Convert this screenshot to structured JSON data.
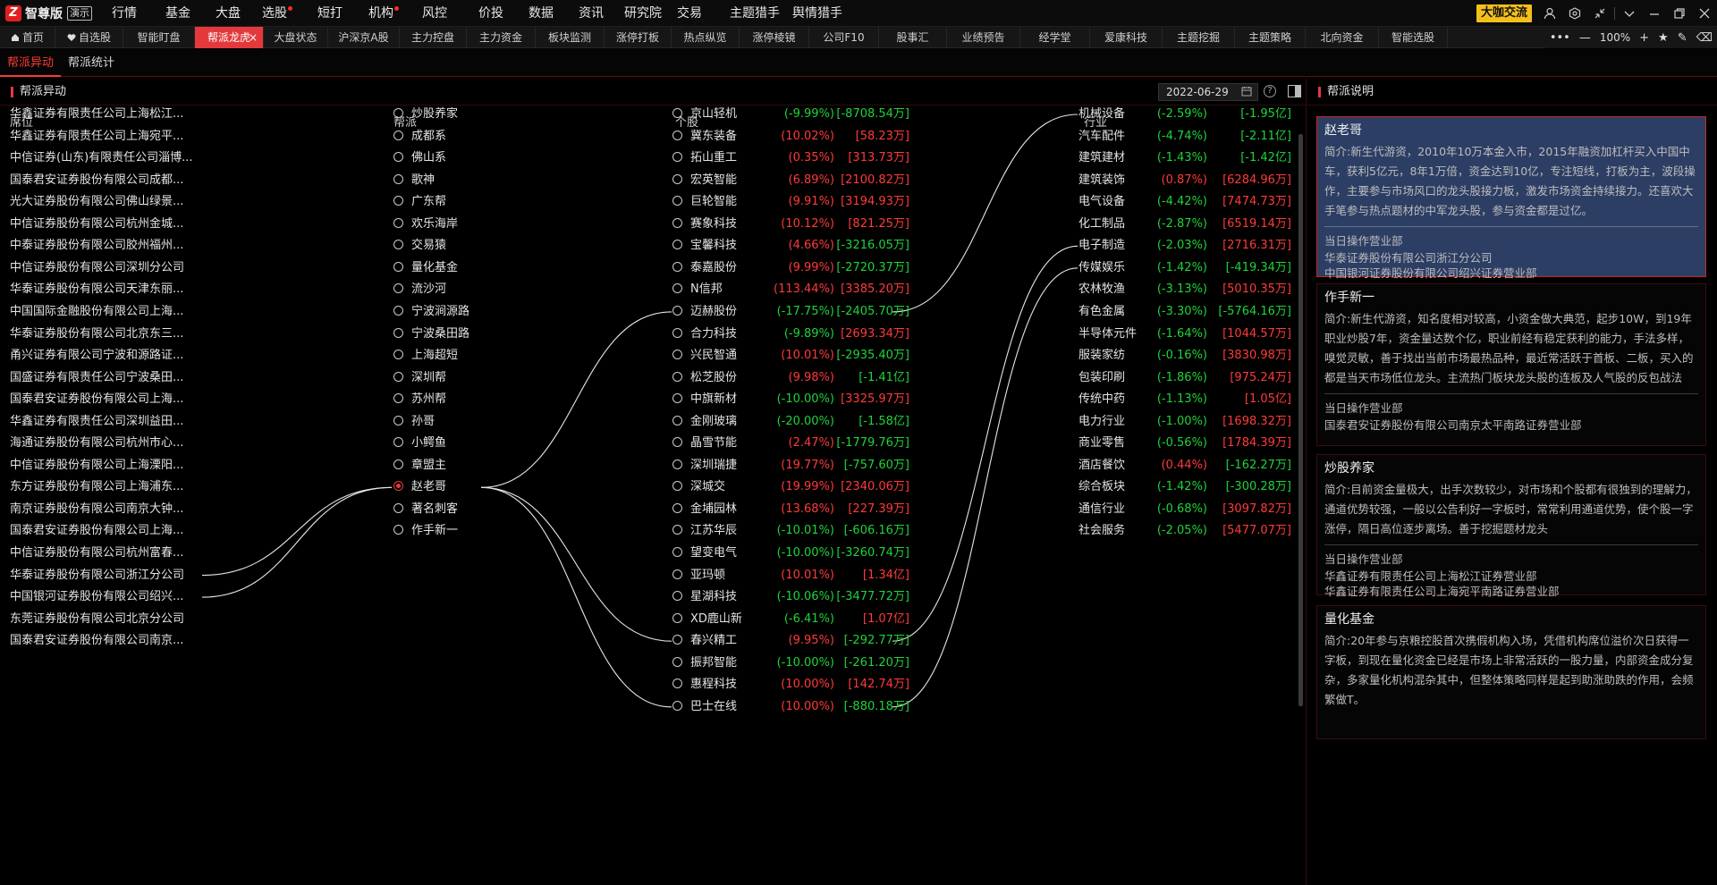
{
  "app": {
    "logo_glyph": "Z",
    "name": "智尊版",
    "demo_badge": "演示"
  },
  "menus": [
    {
      "label": "行情",
      "dot": false
    },
    {
      "label": "基金",
      "dot": false
    },
    {
      "label": "大盘",
      "dot": false
    },
    {
      "label": "选股",
      "dot": true
    },
    {
      "label": "短打",
      "dot": false
    },
    {
      "label": "机构",
      "dot": true
    },
    {
      "label": "风控",
      "dot": false
    },
    {
      "label": "价投",
      "dot": false
    },
    {
      "label": "数据",
      "dot": false
    },
    {
      "label": "资讯",
      "dot": false
    },
    {
      "label": "研究院",
      "dot": false
    },
    {
      "label": "交易",
      "dot": false
    },
    {
      "label": "主题猎手",
      "dot": false
    },
    {
      "label": "舆情猎手",
      "dot": false
    }
  ],
  "topright": {
    "chat_label": "大咖交流",
    "icons": [
      "user-icon",
      "settings-icon",
      "shrink-icon",
      "chevron-down-icon",
      "minimize-icon",
      "restore-icon",
      "close-icon"
    ]
  },
  "tabs": [
    {
      "label": "首页",
      "icon": "home-icon"
    },
    {
      "label": "自选股",
      "icon": "heart-icon"
    },
    {
      "label": "智能盯盘"
    },
    {
      "label": "帮派龙虎",
      "active": true
    },
    {
      "label": "大盘状态"
    },
    {
      "label": "沪深京A股"
    },
    {
      "label": "主力控盘"
    },
    {
      "label": "主力资金"
    },
    {
      "label": "板块监测"
    },
    {
      "label": "涨停打板"
    },
    {
      "label": "热点纵览"
    },
    {
      "label": "涨停棱镜"
    },
    {
      "label": "公司F10"
    },
    {
      "label": "股事汇"
    },
    {
      "label": "业绩预告"
    },
    {
      "label": "经学堂"
    },
    {
      "label": "爱康科技"
    },
    {
      "label": "主题挖掘"
    },
    {
      "label": "主题策略"
    },
    {
      "label": "北向资金"
    },
    {
      "label": "智能选股"
    }
  ],
  "tab_tools": {
    "more": "•••",
    "minus": "—",
    "zoom": "100%",
    "plus": "+",
    "star": "★",
    "edit": "✎",
    "eraser": "⌫"
  },
  "subtabs": [
    {
      "label": "帮派异动",
      "active": true
    },
    {
      "label": "帮派统计",
      "active": false
    }
  ],
  "left": {
    "section_title": "帮派异动",
    "date": "2022-06-29",
    "columns": {
      "seat": "席位",
      "faction": "帮派",
      "stock": "个股",
      "industry": "行业"
    },
    "seats": [
      "华鑫证券有限责任公司上海松江...",
      "华鑫证券有限责任公司上海宛平...",
      "中信证券(山东)有限责任公司淄博...",
      "国泰君安证券股份有限公司成都...",
      "光大证券股份有限公司佛山绿景...",
      "中信证券股份有限公司杭州金城...",
      "中泰证券股份有限公司胶州福州...",
      "中信证券股份有限公司深圳分公司",
      "华泰证券股份有限公司天津东丽...",
      "中国国际金融股份有限公司上海...",
      "华泰证券股份有限公司北京东三...",
      "甬兴证券有限公司宁波和源路证...",
      "国盛证券有限责任公司宁波桑田...",
      "国泰君安证券股份有限公司上海...",
      "华鑫证券有限责任公司深圳益田...",
      "海通证券股份有限公司杭州市心...",
      "中信证券股份有限公司上海溧阳...",
      "东方证券股份有限公司上海浦东...",
      "南京证券股份有限公司南京大钟...",
      "国泰君安证券股份有限公司上海...",
      "中信证券股份有限公司杭州富春...",
      "华泰证券股份有限公司浙江分公司",
      "中国银河证券股份有限公司绍兴...",
      "东莞证券股份有限公司北京分公司",
      "国泰君安证券股份有限公司南京..."
    ],
    "factions": [
      "炒股养家",
      "成都系",
      "佛山系",
      "歌神",
      "广东帮",
      "欢乐海岸",
      "交易猿",
      "量化基金",
      "流沙河",
      "宁波涧源路",
      "宁波桑田路",
      "上海超短",
      "深圳帮",
      "苏州帮",
      "孙哥",
      "小鳄鱼",
      "章盟主",
      "赵老哥",
      "著名刺客",
      "作手新一"
    ],
    "selected_faction": "赵老哥",
    "stocks": [
      {
        "name": "京山轻机",
        "pct": "(-9.99%)",
        "amt": "[-8708.54万]",
        "dir": "dn",
        "amt_dir": "dn"
      },
      {
        "name": "冀东装备",
        "pct": "(10.02%)",
        "amt": "[58.23万]",
        "dir": "up",
        "amt_dir": "up"
      },
      {
        "name": "拓山重工",
        "pct": "(0.35%)",
        "amt": "[313.73万]",
        "dir": "up",
        "amt_dir": "up"
      },
      {
        "name": "宏英智能",
        "pct": "(6.89%)",
        "amt": "[2100.82万]",
        "dir": "up",
        "amt_dir": "up"
      },
      {
        "name": "巨轮智能",
        "pct": "(9.91%)",
        "amt": "[3194.93万]",
        "dir": "up",
        "amt_dir": "up"
      },
      {
        "name": "赛象科技",
        "pct": "(10.12%)",
        "amt": "[821.25万]",
        "dir": "up",
        "amt_dir": "up"
      },
      {
        "name": "宝馨科技",
        "pct": "(4.66%)",
        "amt": "[-3216.05万]",
        "dir": "up",
        "amt_dir": "dn"
      },
      {
        "name": "泰嘉股份",
        "pct": "(9.99%)",
        "amt": "[-2720.37万]",
        "dir": "up",
        "amt_dir": "dn"
      },
      {
        "name": "N信邦",
        "pct": "(113.44%)",
        "amt": "[3385.20万]",
        "dir": "up",
        "amt_dir": "up"
      },
      {
        "name": "迈赫股份",
        "pct": "(-17.75%)",
        "amt": "[-2405.70万]",
        "dir": "dn",
        "amt_dir": "dn"
      },
      {
        "name": "合力科技",
        "pct": "(-9.89%)",
        "amt": "[2693.34万]",
        "dir": "dn",
        "amt_dir": "up"
      },
      {
        "name": "兴民智通",
        "pct": "(10.01%)",
        "amt": "[-2935.40万]",
        "dir": "up",
        "amt_dir": "dn"
      },
      {
        "name": "松芝股份",
        "pct": "(9.98%)",
        "amt": "[-1.41亿]",
        "dir": "up",
        "amt_dir": "dn"
      },
      {
        "name": "中旗新材",
        "pct": "(-10.00%)",
        "amt": "[3325.97万]",
        "dir": "dn",
        "amt_dir": "up"
      },
      {
        "name": "金刚玻璃",
        "pct": "(-20.00%)",
        "amt": "[-1.58亿]",
        "dir": "dn",
        "amt_dir": "dn"
      },
      {
        "name": "晶雪节能",
        "pct": "(2.47%)",
        "amt": "[-1779.76万]",
        "dir": "up",
        "amt_dir": "dn"
      },
      {
        "name": "深圳瑞捷",
        "pct": "(19.77%)",
        "amt": "[-757.60万]",
        "dir": "up",
        "amt_dir": "dn"
      },
      {
        "name": "深城交",
        "pct": "(19.99%)",
        "amt": "[2340.06万]",
        "dir": "up",
        "amt_dir": "up"
      },
      {
        "name": "金埔园林",
        "pct": "(13.68%)",
        "amt": "[227.39万]",
        "dir": "up",
        "amt_dir": "up"
      },
      {
        "name": "江苏华辰",
        "pct": "(-10.01%)",
        "amt": "[-606.16万]",
        "dir": "dn",
        "amt_dir": "dn"
      },
      {
        "name": "望变电气",
        "pct": "(-10.00%)",
        "amt": "[-3260.74万]",
        "dir": "dn",
        "amt_dir": "dn"
      },
      {
        "name": "亚玛顿",
        "pct": "(10.01%)",
        "amt": "[1.34亿]",
        "dir": "up",
        "amt_dir": "up"
      },
      {
        "name": "星湖科技",
        "pct": "(-10.06%)",
        "amt": "[-3477.72万]",
        "dir": "dn",
        "amt_dir": "dn"
      },
      {
        "name": "XD鹿山新",
        "pct": "(-6.41%)",
        "amt": "[1.07亿]",
        "dir": "dn",
        "amt_dir": "up"
      },
      {
        "name": "春兴精工",
        "pct": "(9.95%)",
        "amt": "[-292.77万]",
        "dir": "up",
        "amt_dir": "dn"
      },
      {
        "name": "振邦智能",
        "pct": "(-10.00%)",
        "amt": "[-261.20万]",
        "dir": "dn",
        "amt_dir": "dn"
      },
      {
        "name": "惠程科技",
        "pct": "(10.00%)",
        "amt": "[142.74万]",
        "dir": "up",
        "amt_dir": "up"
      },
      {
        "name": "巴士在线",
        "pct": "(10.00%)",
        "amt": "[-880.18万]",
        "dir": "up",
        "amt_dir": "dn"
      }
    ],
    "industries": [
      {
        "name": "机械设备",
        "pct": "(-2.59%)",
        "amt": "[-1.95亿]",
        "dir": "dn",
        "amt_dir": "dn"
      },
      {
        "name": "汽车配件",
        "pct": "(-4.74%)",
        "amt": "[-2.11亿]",
        "dir": "dn",
        "amt_dir": "dn"
      },
      {
        "name": "建筑建材",
        "pct": "(-1.43%)",
        "amt": "[-1.42亿]",
        "dir": "dn",
        "amt_dir": "dn"
      },
      {
        "name": "建筑装饰",
        "pct": "(0.87%)",
        "amt": "[6284.96万]",
        "dir": "up",
        "amt_dir": "up"
      },
      {
        "name": "电气设备",
        "pct": "(-4.42%)",
        "amt": "[7474.73万]",
        "dir": "dn",
        "amt_dir": "up"
      },
      {
        "name": "化工制品",
        "pct": "(-2.87%)",
        "amt": "[6519.14万]",
        "dir": "dn",
        "amt_dir": "up"
      },
      {
        "name": "电子制造",
        "pct": "(-2.03%)",
        "amt": "[2716.31万]",
        "dir": "dn",
        "amt_dir": "up"
      },
      {
        "name": "传媒娱乐",
        "pct": "(-1.42%)",
        "amt": "[-419.34万]",
        "dir": "dn",
        "amt_dir": "dn"
      },
      {
        "name": "农林牧渔",
        "pct": "(-3.13%)",
        "amt": "[5010.35万]",
        "dir": "dn",
        "amt_dir": "up"
      },
      {
        "name": "有色金属",
        "pct": "(-3.30%)",
        "amt": "[-5764.16万]",
        "dir": "dn",
        "amt_dir": "dn"
      },
      {
        "name": "半导体元件",
        "pct": "(-1.64%)",
        "amt": "[1044.57万]",
        "dir": "dn",
        "amt_dir": "up"
      },
      {
        "name": "服装家纺",
        "pct": "(-0.16%)",
        "amt": "[3830.98万]",
        "dir": "dn",
        "amt_dir": "up"
      },
      {
        "name": "包装印刷",
        "pct": "(-1.86%)",
        "amt": "[975.24万]",
        "dir": "dn",
        "amt_dir": "up"
      },
      {
        "name": "传统中药",
        "pct": "(-1.13%)",
        "amt": "[1.05亿]",
        "dir": "dn",
        "amt_dir": "up"
      },
      {
        "name": "电力行业",
        "pct": "(-1.00%)",
        "amt": "[1698.32万]",
        "dir": "dn",
        "amt_dir": "up"
      },
      {
        "name": "商业零售",
        "pct": "(-0.56%)",
        "amt": "[1784.39万]",
        "dir": "dn",
        "amt_dir": "up"
      },
      {
        "name": "酒店餐饮",
        "pct": "(0.44%)",
        "amt": "[-162.27万]",
        "dir": "up",
        "amt_dir": "dn"
      },
      {
        "name": "综合板块",
        "pct": "(-1.42%)",
        "amt": "[-300.28万]",
        "dir": "dn",
        "amt_dir": "dn"
      },
      {
        "name": "通信行业",
        "pct": "(-0.68%)",
        "amt": "[3097.82万]",
        "dir": "dn",
        "amt_dir": "up"
      },
      {
        "name": "社会服务",
        "pct": "(-2.05%)",
        "amt": "[5477.07万]",
        "dir": "dn",
        "amt_dir": "up"
      }
    ],
    "links": {
      "seat_to_faction": [
        [
          21,
          17
        ],
        [
          22,
          17
        ]
      ],
      "faction_to_stock": [
        [
          17,
          9
        ],
        [
          17,
          24
        ],
        [
          17,
          27
        ]
      ],
      "stock_to_industry": [
        [
          9,
          0
        ],
        [
          24,
          6
        ],
        [
          27,
          7
        ]
      ]
    }
  },
  "right": {
    "section_title": "帮派说明",
    "op_label": "当日操作营业部",
    "cards": [
      {
        "name": "赵老哥",
        "selected": true,
        "desc": "简介:新生代游资，2010年10万本金入市，2015年融资加杠杆买入中国中车，获利5亿元，8年1万倍，资金达到10亿，专注短线，打板为主，波段操作，主要参与市场风口的龙头股接力板，激发市场资金持续接力。还喜欢大手笔参与热点题材的中军龙头股，参与资金都是过亿。",
        "depts": [
          "华泰证券股份有限公司浙江分公司",
          "中国银河证券股份有限公司绍兴证券营业部"
        ]
      },
      {
        "name": "作手新一",
        "selected": false,
        "desc": "简介:新生代游资，知名度相对较高，小资金做大典范，起步10W，到19年职业炒股7年，资金量达数个亿，职业前经有稳定获利的能力，手法多样，嗅觉灵敏，善于找出当前市场最热品种，最近常活跃于首板、二板，买入的都是当天市场低位龙头。主流热门板块龙头股的连板及人气股的反包战法",
        "depts": [
          "国泰君安证券股份有限公司南京太平南路证券营业部"
        ]
      },
      {
        "name": "炒股养家",
        "selected": false,
        "desc": "简介:目前资金量极大，出手次数较少，对市场和个股都有很独到的理解力，通道优势较强，一般以公告利好一字板时，常常利用通道优势，使个股一字涨停，隔日高位逐步离场。善于挖掘题材龙头",
        "depts": [
          "华鑫证券有限责任公司上海松江证券营业部",
          "华鑫证券有限责任公司上海宛平南路证券营业部"
        ]
      },
      {
        "name": "量化基金",
        "selected": false,
        "desc": "简介:20年参与京粮控股首次携假机构入场，凭借机构席位溢价次日获得一字板，到现在量化资金已经是市场上非常活跃的一股力量，内部资金成分复杂，多家量化机构混杂其中，但整体策略同样是起到助涨助跌的作用，会频繁做T。",
        "depts": []
      }
    ]
  }
}
